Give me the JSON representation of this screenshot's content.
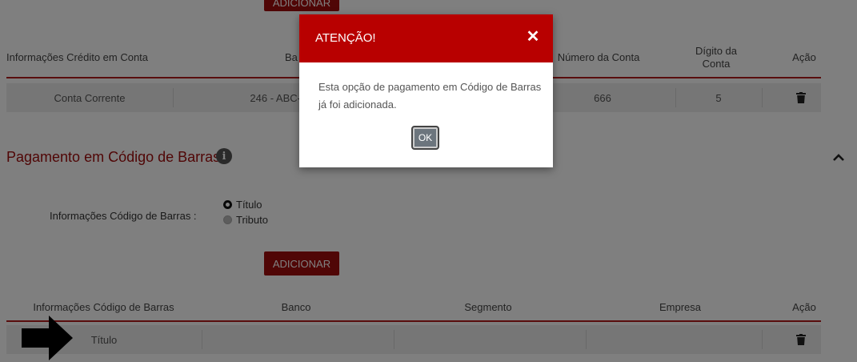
{
  "top": {
    "add_button": "ADICIONAR",
    "headers": [
      "Informações Crédito em Conta",
      "Ba",
      "Número da Conta",
      "Dígito da Conta",
      "Ação"
    ],
    "row": [
      "Conta Corrente",
      "246 - ABC-",
      "666",
      "5"
    ]
  },
  "section": {
    "title": "Pagamento em Código de Barras",
    "field_label": "Informações Código de Barras :",
    "radio_options": [
      {
        "label": "Título",
        "selected": true
      },
      {
        "label": "Tributo",
        "selected": false
      }
    ],
    "add_button": "ADICIONAR",
    "headers": [
      "Informações Código de Barras",
      "Banco",
      "Segmento",
      "Empresa",
      "Ação"
    ],
    "row": [
      "Título",
      "",
      "",
      ""
    ]
  },
  "modal": {
    "title": "ATENÇÃO!",
    "message": "Esta opção de pagamento em Código de Barras já foi adicionada.",
    "ok_label": "OK"
  },
  "colors": {
    "brand_red": "#a10d0d",
    "modal_header": "#b80000",
    "overlay": "rgba(0,0,0,0.5)"
  },
  "icons": [
    "info-icon",
    "chevron-up-icon",
    "trash-icon",
    "close-icon",
    "arrow-right-icon"
  ]
}
